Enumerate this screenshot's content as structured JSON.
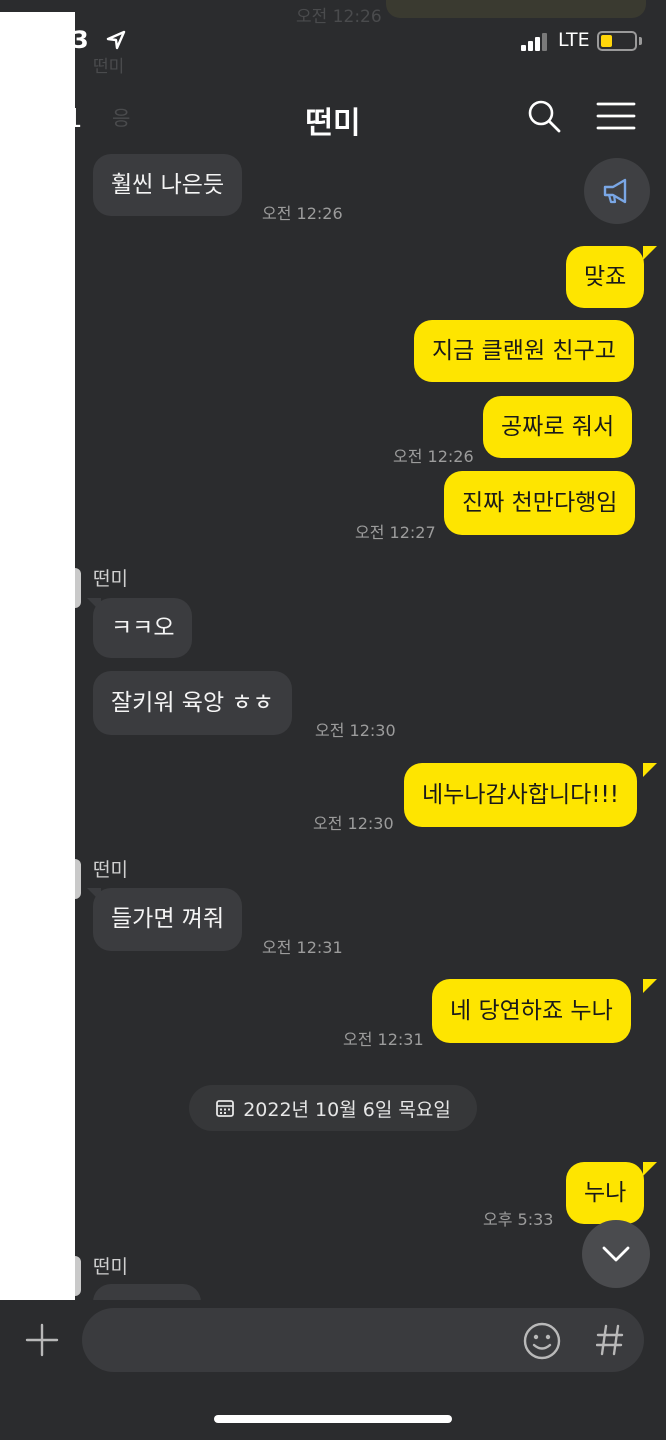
{
  "status_bar": {
    "time": "3",
    "network": "LTE"
  },
  "header": {
    "back_count": "1",
    "title": "떤미"
  },
  "ghost": {
    "top_time": "오전 12:26",
    "top_sender": "떤미",
    "top_reply": "응"
  },
  "messages": [
    {
      "dir": "in",
      "text": "훨씬 나은듯",
      "time": "오전 12:26"
    },
    {
      "dir": "out",
      "text": "맞죠"
    },
    {
      "dir": "out",
      "text": "지금 클랜원 친구고"
    },
    {
      "dir": "out",
      "text": "공짜로 줘서",
      "time": "오전 12:26"
    },
    {
      "dir": "out",
      "text": "진짜 천만다행임",
      "time": "오전 12:27"
    },
    {
      "dir": "in",
      "sender": "떤미",
      "text": "ㅋㅋ오"
    },
    {
      "dir": "in",
      "text": "잘키워 육앙 ㅎㅎ",
      "time": "오전 12:30"
    },
    {
      "dir": "out",
      "text": "네누나감사합니다!!!",
      "time": "오전 12:30"
    },
    {
      "dir": "in",
      "sender": "떤미",
      "text": "들가면 껴줘",
      "time": "오전 12:31"
    },
    {
      "dir": "out",
      "text": "네 당연하죠 누나",
      "time": "오전 12:31"
    },
    {
      "dir": "out",
      "text": "누나",
      "time": "오후 5:33"
    }
  ],
  "date_divider": "2022년 10월 6일 목요일",
  "last_sender": "떤미",
  "colors": {
    "accent": "#fee500",
    "background": "#2b2c2e",
    "incoming": "#3b3c3f"
  },
  "icons": [
    "location-arrow-icon",
    "signal-icon",
    "battery-icon",
    "search-icon",
    "menu-icon",
    "megaphone-icon",
    "calendar-icon",
    "chevron-down-icon",
    "plus-icon",
    "emoji-icon",
    "hash-icon"
  ]
}
